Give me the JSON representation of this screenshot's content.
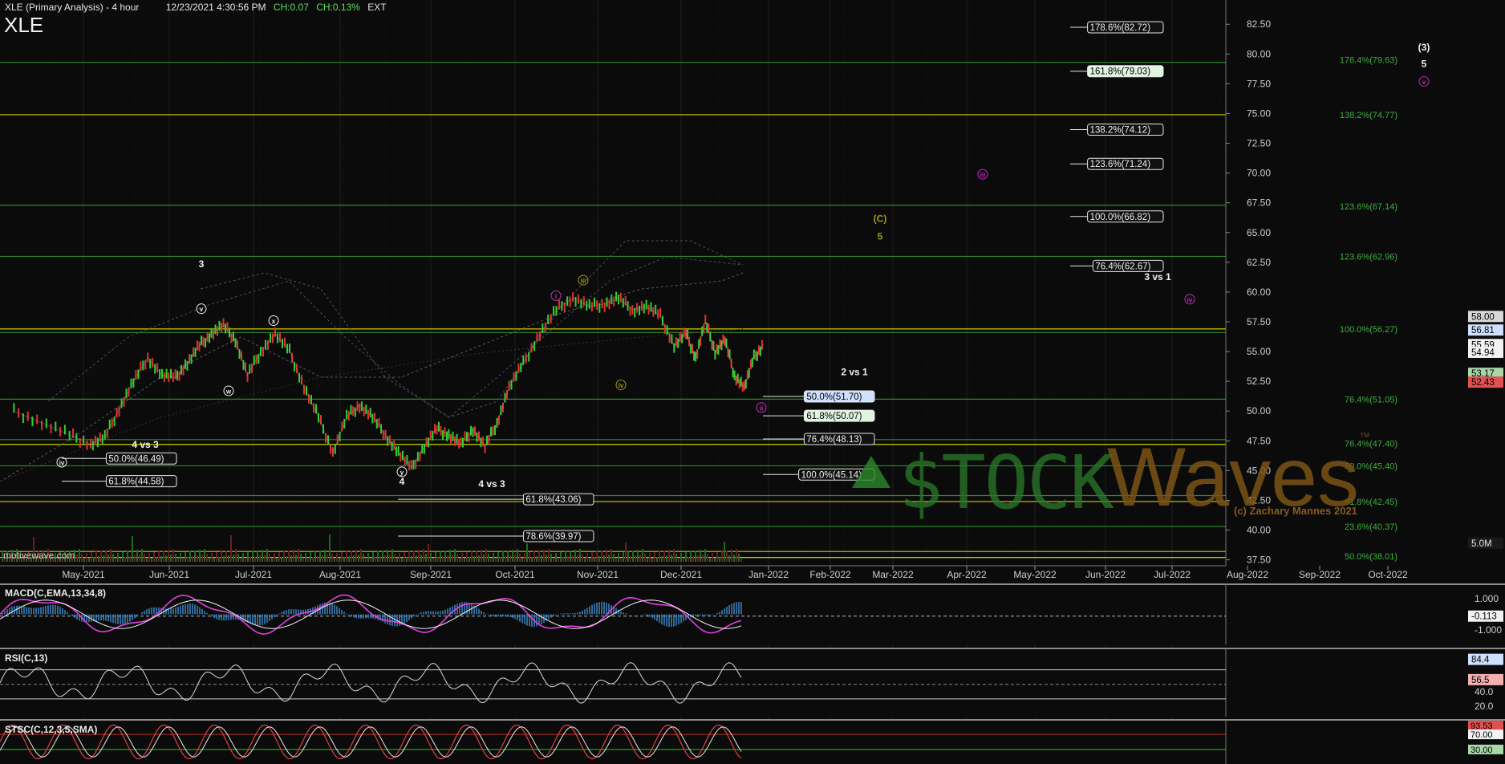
{
  "header": {
    "title": "XLE (Primary Analysis) - 4 hour",
    "timestamp": "12/23/2021 4:30:56 PM",
    "change": "CH:0.07",
    "change_pct": "CH:0.13%",
    "session": "EXT"
  },
  "symbol": "XLE",
  "watermark": "motivewave.com",
  "copyright": "(c) Zachary Mannes 2021",
  "brand": {
    "part1": "$TOCK",
    "part2": "Waves",
    "tm": "™",
    "green": "#2a8a2a",
    "brown": "#8a5a1e"
  },
  "chart_data": [
    {
      "type": "line",
      "panel": "price",
      "y_axis_ticks": [
        "82.50",
        "80.00",
        "77.50",
        "75.00",
        "72.50",
        "70.00",
        "67.50",
        "65.00",
        "62.50",
        "60.00",
        "57.50",
        "55.00",
        "52.50",
        "50.00",
        "47.50",
        "45.00",
        "42.50",
        "40.00",
        "37.50"
      ],
      "ylim": [
        37.0,
        84.0
      ],
      "x_axis_ticks": [
        "May-2021",
        "Jun-2021",
        "Jul-2021",
        "Aug-2021",
        "Sep-2021",
        "Oct-2021",
        "Nov-2021",
        "Dec-2021",
        "Jan-2022",
        "Feb-2022",
        "Mar-2022",
        "Apr-2022",
        "May-2022",
        "Jun-2022",
        "Jul-2022",
        "Aug-2022",
        "Sep-2022",
        "Oct-2022"
      ],
      "price_path": [
        [
          "Apr-2021",
          50.0
        ],
        [
          "Apr-2021",
          49.0
        ],
        [
          "Apr-2021",
          48.0
        ],
        [
          "May-2021",
          47.2
        ],
        [
          "May-2021",
          47.8
        ],
        [
          "May-2021",
          50.2
        ],
        [
          "May-2021",
          52.5
        ],
        [
          "May-2021",
          54.5
        ],
        [
          "May-2021",
          53.0
        ],
        [
          "Jun-2021",
          52.8
        ],
        [
          "Jun-2021",
          54.0
        ],
        [
          "Jun-2021",
          55.5
        ],
        [
          "Jun-2021",
          56.5
        ],
        [
          "Jun-2021",
          57.2
        ],
        [
          "Jun-2021",
          56.0
        ],
        [
          "Jun-2021",
          53.0
        ],
        [
          "Jul-2021",
          55.0
        ],
        [
          "Jul-2021",
          56.5
        ],
        [
          "Jul-2021",
          55.0
        ],
        [
          "Jul-2021",
          52.0
        ],
        [
          "Jul-2021",
          49.5
        ],
        [
          "Jul-2021",
          46.5
        ],
        [
          "Aug-2021",
          49.5
        ],
        [
          "Aug-2021",
          50.5
        ],
        [
          "Aug-2021",
          49.5
        ],
        [
          "Aug-2021",
          48.0
        ],
        [
          "Aug-2021",
          46.5
        ],
        [
          "Aug-2021",
          45.2
        ],
        [
          "Aug-2021",
          47.0
        ],
        [
          "Sep-2021",
          48.5
        ],
        [
          "Sep-2021",
          48.0
        ],
        [
          "Sep-2021",
          47.2
        ],
        [
          "Sep-2021",
          48.5
        ],
        [
          "Sep-2021",
          47.0
        ],
        [
          "Sep-2021",
          49.0
        ],
        [
          "Sep-2021",
          52.0
        ],
        [
          "Oct-2021",
          54.0
        ],
        [
          "Oct-2021",
          56.5
        ],
        [
          "Oct-2021",
          58.5
        ],
        [
          "Oct-2021",
          59.5
        ],
        [
          "Oct-2021",
          58.8
        ],
        [
          "Nov-2021",
          59.0
        ],
        [
          "Nov-2021",
          59.5
        ],
        [
          "Nov-2021",
          58.5
        ],
        [
          "Nov-2021",
          58.8
        ],
        [
          "Nov-2021",
          58.0
        ],
        [
          "Nov-2021",
          55.5
        ],
        [
          "Dec-2021",
          56.5
        ],
        [
          "Dec-2021",
          54.5
        ],
        [
          "Dec-2021",
          57.5
        ],
        [
          "Dec-2021",
          55.0
        ],
        [
          "Dec-2021",
          56.0
        ],
        [
          "Dec-2021",
          53.0
        ],
        [
          "Dec-2021",
          52.0
        ],
        [
          "Dec-2021",
          54.5
        ],
        [
          "Dec-2021",
          55.6
        ]
      ],
      "horizontal_lines": [
        {
          "price": 79.3,
          "color": "#2e8b2e"
        },
        {
          "price": 74.9,
          "color": "#cccc00"
        },
        {
          "price": 67.3,
          "color": "#2e8b2e"
        },
        {
          "price": 63.0,
          "color": "#2e8b2e"
        },
        {
          "price": 56.9,
          "color": "#cccc00"
        },
        {
          "price": 56.6,
          "color": "#2e8b2e"
        },
        {
          "price": 51.0,
          "color": "#2e8b2e"
        },
        {
          "price": 47.6,
          "color": "#2e8b2e"
        },
        {
          "price": 47.2,
          "color": "#cccc00"
        },
        {
          "price": 45.4,
          "color": "#2e8b2e"
        },
        {
          "price": 42.9,
          "color": "#2e8b2e"
        },
        {
          "price": 42.4,
          "color": "#cccc00"
        },
        {
          "price": 40.3,
          "color": "#2e8b2e"
        },
        {
          "price": 38.2,
          "color": "#cccc00"
        },
        {
          "price": 37.7,
          "color": "#cccc00"
        }
      ],
      "fib_boxes": [
        {
          "text": "178.6%(82.72)",
          "price": 82.72,
          "x": "May-2022"
        },
        {
          "text": "161.8%(79.03)",
          "price": 79.03,
          "x": "May-2022"
        },
        {
          "text": "138.2%(74.12)",
          "price": 74.12,
          "x": "May-2022"
        },
        {
          "text": "123.6%(71.24)",
          "price": 71.24,
          "x": "May-2022"
        },
        {
          "text": "100.0%(66.82)",
          "price": 66.82,
          "x": "May-2022"
        },
        {
          "text": "76.4%(62.67)",
          "price": 62.67,
          "x": "May-2022"
        },
        {
          "text": "50.0%(51.70)",
          "price": 51.7,
          "x": "Jan-2022"
        },
        {
          "text": "61.8%(50.07)",
          "price": 50.07,
          "x": "Jan-2022"
        },
        {
          "text": "76.4%(48.13)",
          "price": 48.13,
          "x": "Jan-2022"
        },
        {
          "text": "100.0%(45.14)",
          "price": 45.14,
          "x": "Jan-2022"
        },
        {
          "text": "50.0%(46.49)",
          "price": 46.49,
          "x": "May-2021"
        },
        {
          "text": "61.8%(44.58)",
          "price": 44.58,
          "x": "May-2021"
        },
        {
          "text": "61.8%(43.06)",
          "price": 43.06,
          "x": "Sep-2021"
        },
        {
          "text": "78.6%(39.97)",
          "price": 39.97,
          "x": "Sep-2021"
        }
      ],
      "right_fib_labels": [
        {
          "text": "176.4%(79.63)",
          "price": 79.5
        },
        {
          "text": "138.2%(74.77)",
          "price": 74.9
        },
        {
          "text": "123.6%(67.14)",
          "price": 67.2
        },
        {
          "text": "123.6%(62.96)",
          "price": 63.0
        },
        {
          "text": "100.0%(56.27)",
          "price": 56.9
        },
        {
          "text": "76.4%(51.05)",
          "price": 51.0
        },
        {
          "text": "76.4%(47.40)",
          "price": 47.3
        },
        {
          "text": "50.0%(45.40)",
          "price": 45.4
        },
        {
          "text": "61.8%(42.45)",
          "price": 42.4
        },
        {
          "text": "23.6%(40.37)",
          "price": 40.3
        },
        {
          "text": "50.0%(38.01)",
          "price": 37.8
        }
      ],
      "annotations": [
        {
          "text": "3",
          "x": "Jun-2021",
          "price": 62.1,
          "color": "#f2f2f2"
        },
        {
          "text": "2 vs 1",
          "x": "Jan-2022",
          "price": 53.0,
          "color": "#f2f2f2"
        },
        {
          "text": "4 vs 3",
          "x": "May-2021",
          "price": 46.9,
          "color": "#f2f2f2"
        },
        {
          "text": "4 vs 3",
          "x": "Sep-2021",
          "price": 43.6,
          "color": "#f2f2f2"
        },
        {
          "text": "3 vs 1",
          "x": "Jun-2022",
          "price": 61.0,
          "color": "#f2f2f2"
        },
        {
          "text": "4",
          "x": "Aug-2021",
          "price": 43.8,
          "color": "#f2f2f2"
        },
        {
          "text": "(3)",
          "x": "Sep-2022",
          "price": 80.3,
          "color": "#f2f2f2"
        },
        {
          "text": "5",
          "x": "Sep-2022",
          "price": 78.9,
          "color": "#f2f2f2"
        },
        {
          "text": "(C)",
          "x": "Feb-2022",
          "price": 65.9,
          "color": "#a09a1a"
        },
        {
          "text": "5",
          "x": "Feb-2022",
          "price": 64.4,
          "color": "#a09a1a"
        },
        {
          "text": "v",
          "x": "Jun-2021",
          "price": 58.6,
          "color": "#f2f2f2",
          "circled": true
        },
        {
          "text": "iv",
          "x": "May-2021",
          "price": 45.7,
          "color": "#f2f2f2",
          "circled": true
        },
        {
          "text": "w",
          "x": "Jun-2021",
          "price": 51.7,
          "color": "#f2f2f2",
          "circled": true
        },
        {
          "text": "x",
          "x": "Jul-2021",
          "price": 57.6,
          "color": "#f2f2f2",
          "circled": true
        },
        {
          "text": "y",
          "x": "Aug-2021",
          "price": 44.9,
          "color": "#f2f2f2",
          "circled": true
        },
        {
          "text": "i",
          "x": "Oct-2021",
          "price": 59.7,
          "color": "#c030c0",
          "circled": true
        },
        {
          "text": "iii",
          "x": "Oct-2021",
          "price": 61.0,
          "color": "#a09a1a",
          "circled": true
        },
        {
          "text": "iv",
          "x": "Dec-2021",
          "price": 52.2,
          "color": "#a09a1a",
          "circled": true
        },
        {
          "text": "ii",
          "x": "Jan-2022",
          "price": 50.3,
          "color": "#c030c0",
          "circled": true
        },
        {
          "text": "iii",
          "x": "May-2022",
          "price": 69.9,
          "color": "#c030c0",
          "circled": true
        },
        {
          "text": "iv",
          "x": "Jun-2022",
          "price": 59.4,
          "color": "#c030c0",
          "circled": true
        },
        {
          "text": "v",
          "x": "Sep-2022",
          "price": 77.7,
          "color": "#c030c0",
          "circled": true
        }
      ],
      "price_badges": [
        {
          "text": "58.00",
          "price": 57.95,
          "bg": "#d8d8d8",
          "fg": "#000"
        },
        {
          "text": "56.81",
          "price": 56.81,
          "bg": "#cfe0ff",
          "fg": "#000"
        },
        {
          "text": "55.59",
          "price": 55.59,
          "bg": "#f2f2f2",
          "fg": "#000"
        },
        {
          "text": "54.94",
          "price": 54.94,
          "bg": "#f2f2f2",
          "fg": "#000"
        },
        {
          "text": "53.17",
          "price": 53.17,
          "bg": "#a8d8a8",
          "fg": "#000"
        },
        {
          "text": "52.43",
          "price": 52.43,
          "bg": "#e05050",
          "fg": "#000"
        },
        {
          "text": "5.0M",
          "price": 38.9,
          "bg": "#1a1a1a",
          "fg": "#e6e6e6"
        }
      ]
    },
    {
      "type": "line",
      "panel": "macd",
      "title": "MACD(C,EMA,13,34,8)",
      "y_axis_ticks": [
        "1.000",
        "-0.113",
        "-1.000"
      ],
      "ylim": [
        -1.5,
        1.5
      ],
      "current_value": "-0.113"
    },
    {
      "type": "line",
      "panel": "rsi",
      "title": "RSI(C,13)",
      "y_axis_ticks": [
        "84.4",
        "56.5",
        "40.0",
        "20.0"
      ],
      "ylim": [
        10,
        95
      ],
      "overbought": 70,
      "oversold": 30,
      "current_value": "56.5"
    },
    {
      "type": "line",
      "panel": "stoch",
      "title": "STSC(C,12,3,5,SMA)",
      "y_axis_ticks": [
        "93.53",
        "70.00",
        "30.00"
      ],
      "ylim": [
        0,
        100
      ],
      "overbought": 70,
      "oversold": 30
    }
  ]
}
